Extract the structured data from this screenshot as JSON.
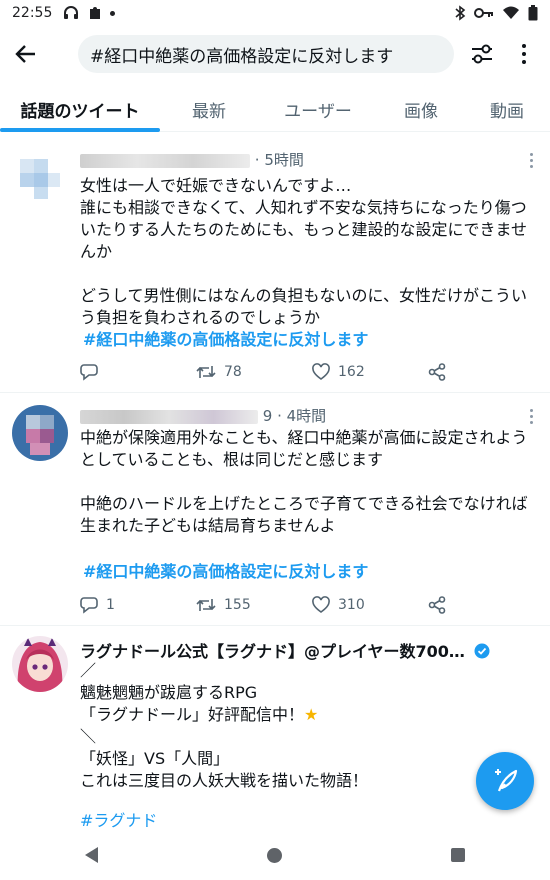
{
  "status_bar": {
    "time": "22:55",
    "icons": [
      "headset-icon",
      "puzzle-icon",
      "dot-icon",
      "bluetooth-icon",
      "key-icon",
      "wifi-icon",
      "battery-icon"
    ]
  },
  "search": {
    "query": "#経口中絶薬の高価格設定に反対します"
  },
  "tabs": [
    {
      "label": "話題のツイート",
      "active": true
    },
    {
      "label": "最新",
      "active": false
    },
    {
      "label": "ユーザー",
      "active": false
    },
    {
      "label": "画像",
      "active": false
    },
    {
      "label": "動画",
      "active": false
    }
  ],
  "tweets": [
    {
      "time": "· 5時間",
      "paragraphs": [
        "女性は一人で妊娠できないんですよ…\n誰にも相談できなくて、人知れず不安な気持ちになったり傷ついたりする人たちのためにも、もっと建設的な設定にできませんか",
        "どうして男性側にはなんの負担もないのに、女性だけがこういう負担を負わされるのでしょうか"
      ],
      "hashtag": "#経口中絶薬の高価格設定に反対します",
      "replies": "",
      "retweets": "78",
      "likes": "162"
    },
    {
      "time": "9 · 4時間",
      "paragraphs": [
        "中絶が保険適用外なことも、経口中絶薬が高価に設定されようとしていることも、根は同じだと感じます",
        "中絶のハードルを上げたところで子育てできる社会でなければ生まれた子どもは結局育ちませんよ"
      ],
      "hashtag": "#経口中絶薬の高価格設定に反対します",
      "replies": "1",
      "retweets": "155",
      "likes": "310"
    },
    {
      "name": "ラグナドール公式【ラグナド】@プレイヤー数700…",
      "verified": true,
      "lines": [
        "／",
        "魑魅魍魎が跋扈するRPG",
        "「ラグナドール」好評配信中！",
        "＼",
        "「妖怪」VS「人間」",
        "これは三度目の人妖大戦を描いた物語！"
      ],
      "star": "★",
      "hashtag": "#ラグナド"
    }
  ],
  "colors": {
    "accent": "#1d9bf0",
    "text": "#0f1419",
    "muted": "#536471",
    "search_bg": "#eff3f4",
    "star": "#f7b500"
  }
}
